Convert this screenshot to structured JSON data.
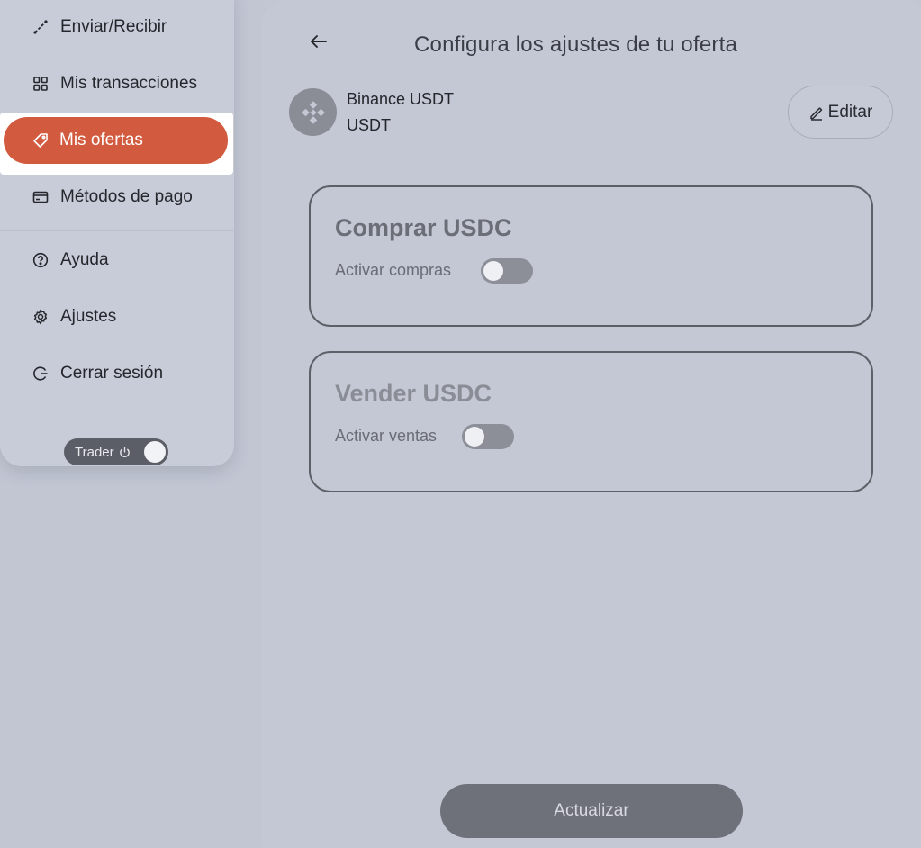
{
  "sidebar": {
    "items": [
      {
        "label": "Enviar/Recibir",
        "icon": "arrows-diagonal-icon"
      },
      {
        "label": "Mis transacciones",
        "icon": "grid-icon"
      },
      {
        "label": "Mis ofertas",
        "icon": "tag-icon",
        "active": true
      },
      {
        "label": "Métodos de pago",
        "icon": "card-icon"
      },
      {
        "label": "Ayuda",
        "icon": "help-circle-icon"
      },
      {
        "label": "Ajustes",
        "icon": "gear-icon"
      },
      {
        "label": "Cerrar sesión",
        "icon": "logout-icon"
      }
    ],
    "trader_toggle": {
      "label": "Trader",
      "state": "on"
    },
    "accent_color": "#d25b3f"
  },
  "main": {
    "title": "Configura los ajustes de tu oferta",
    "asset": {
      "name": "Binance USDT",
      "symbol": "USDT",
      "icon": "binance-icon"
    },
    "edit_label": "Editar",
    "buy_card": {
      "title": "Comprar USDC",
      "toggle_label": "Activar compras",
      "enabled": false
    },
    "sell_card": {
      "title": "Vender USDC",
      "toggle_label": "Activar ventas",
      "enabled": false
    },
    "update_label": "Actualizar"
  }
}
